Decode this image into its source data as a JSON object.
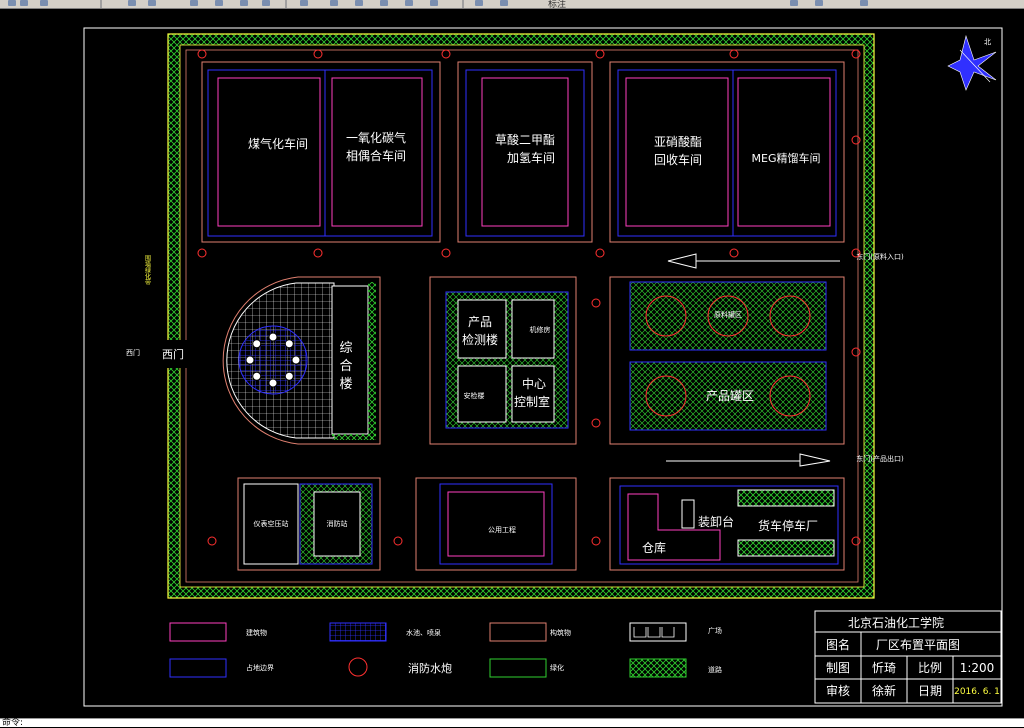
{
  "toolbar": {
    "text": "标注"
  },
  "compass": {
    "north": "北"
  },
  "buildings": {
    "coal_gas": "煤气化车间",
    "co_line1": "一氧化碳气",
    "co_line2": "相偶合车间",
    "oxalate_line1": "草酸二甲酯",
    "oxalate_line2": "加氢车间",
    "nitrite_line1": "亚硝酸酯",
    "nitrite_line2": "回收车间",
    "meg": "MEG精馏车间",
    "complex_line1": "综",
    "complex_line2": "合",
    "complex_line3": "楼",
    "product_test_line1": "产品",
    "product_test_line2": "检测楼",
    "small_top_right": "机修房",
    "small_bottom_left": "安检楼",
    "control_line1": "中心",
    "control_line2": "控制室",
    "raw_tank": "原料罐区",
    "product_tank": "产品罐区",
    "left_bottom_1": "仪表空压站",
    "left_bottom_2": "消防站",
    "middle_bottom": "公用工程",
    "warehouse": "仓库",
    "loading": "装卸台",
    "truck_parking": "货车停车厂"
  },
  "gates": {
    "west": "西门",
    "west_small": "西门",
    "east_raw": "东门(原料入口)",
    "east_product": "东门(产品出口)",
    "west_side_note": "围墙绿化带"
  },
  "legend": [
    {
      "label": "建筑物",
      "shape": "magenta-rect"
    },
    {
      "label": "水池、喷泉",
      "shape": "grid"
    },
    {
      "label": "构筑物",
      "shape": "salmon-rect"
    },
    {
      "label": "广场",
      "shape": "parking"
    },
    {
      "label": "占地边界",
      "shape": "blue-rect"
    },
    {
      "label": "消防水炮",
      "shape": "red-circle"
    },
    {
      "label": "绿化",
      "shape": "green-rect"
    },
    {
      "label": "道路",
      "shape": "hatch"
    }
  ],
  "title_block": {
    "school": "北京石油化工学院",
    "r2_label": "图名",
    "r2_value": "厂区布置平面图",
    "r3_label": "制图",
    "r3_value": "忻琦",
    "r3_label2": "比例",
    "r3_value2": "1:200",
    "r4_label": "审核",
    "r4_value": "徐新",
    "r4_label2": "日期",
    "r4_value2": "2016. 6. 1"
  },
  "colors": {
    "background": "#000000",
    "building": "#ff40c0",
    "boundary": "#e08070",
    "inner": "#3030ff",
    "green": "#30d030",
    "hydrant": "#ff3030",
    "road_edge": "#ffff40"
  },
  "command": {
    "prompt": "命令:"
  }
}
